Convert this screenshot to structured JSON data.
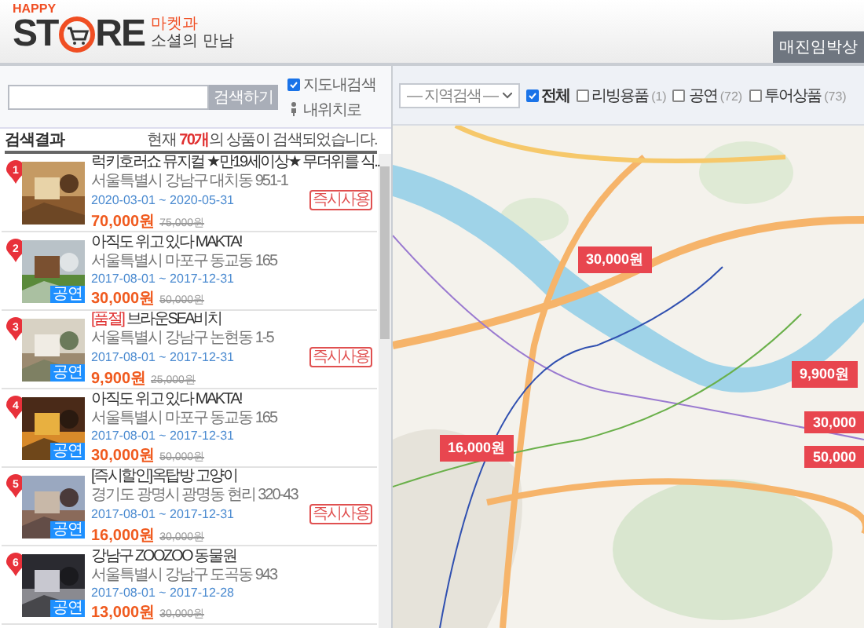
{
  "header": {
    "logo": {
      "small": "HAPPY",
      "left": "ST",
      "right": "RE"
    },
    "slogan_top": "마켓과",
    "slogan_bottom": "소셜의 만남",
    "tab": "매진임박상"
  },
  "search": {
    "button": "검색하기",
    "options": [
      {
        "label": "지도내검색",
        "kind": "checkbox",
        "checked": true
      },
      {
        "label": "내위치로",
        "kind": "location"
      }
    ]
  },
  "results": {
    "title": "검색결과",
    "summary_before": "현재 ",
    "count": "70개",
    "summary_after": "의 상품이 검색되었습니다."
  },
  "items": [
    {
      "number": "1",
      "title": "럭키호러쇼 뮤지컬 ★만19세이상★ 무더위를 식..",
      "address": "서울특별시 강남구 대치동 951-1",
      "dates": "2020-03-01 ~ 2020-05-31",
      "price": "70,000원",
      "old_price": "75,000원",
      "tag": "즉시사용"
    },
    {
      "number": "2",
      "title": "아직도 위고 있다 MAKTA!",
      "address": "서울특별시 마포구 동교동 165",
      "dates": "2017-08-01 ~ 2017-12-31",
      "price": "30,000원",
      "old_price": "50,000원",
      "badge": "공연"
    },
    {
      "number": "3",
      "prefix": "[품절]",
      "title": " 브라운SEA비치",
      "address": "서울특별시 강남구 논현동 1-5",
      "dates": "2017-08-01 ~ 2017-12-31",
      "price": "9,900원",
      "old_price": "25,000원",
      "tag": "즉시사용",
      "badge": "공연"
    },
    {
      "number": "4",
      "title": "아직도 위고 있다 MAKTA!",
      "address": "서울특별시 마포구 동교동 165",
      "dates": "2017-08-01 ~ 2017-12-31",
      "price": "30,000원",
      "old_price": "50,000원",
      "badge": "공연"
    },
    {
      "number": "5",
      "title": "[즉시할인]옥탑방 고양이",
      "address": "경기도 광명시 광명동 현리 320-43",
      "dates": "2017-08-01 ~ 2017-12-31",
      "price": "16,000원",
      "old_price": "30,000원",
      "tag": "즉시사용",
      "badge": "공연"
    },
    {
      "number": "6",
      "title": "강남구 ZOOZOO 동물원",
      "address": "서울특별시 강남구 도곡동 943",
      "dates": "2017-08-01 ~ 2017-12-28",
      "price": "13,000원",
      "old_price": "30,000원",
      "badge": "공연"
    }
  ],
  "filters": {
    "region": "— 지역검색 —",
    "categories": [
      {
        "label": "전체",
        "checked": true
      },
      {
        "label": "리빙용품",
        "count": "(1)",
        "checked": false
      },
      {
        "label": "공연",
        "count": "(72)",
        "checked": false
      },
      {
        "label": "투어상품",
        "count": "(73)",
        "checked": false
      }
    ]
  },
  "map": {
    "kind": "picture",
    "markers": [
      "30,000원",
      "16,000원",
      "9,900원",
      "30,000",
      "50,000"
    ]
  }
}
